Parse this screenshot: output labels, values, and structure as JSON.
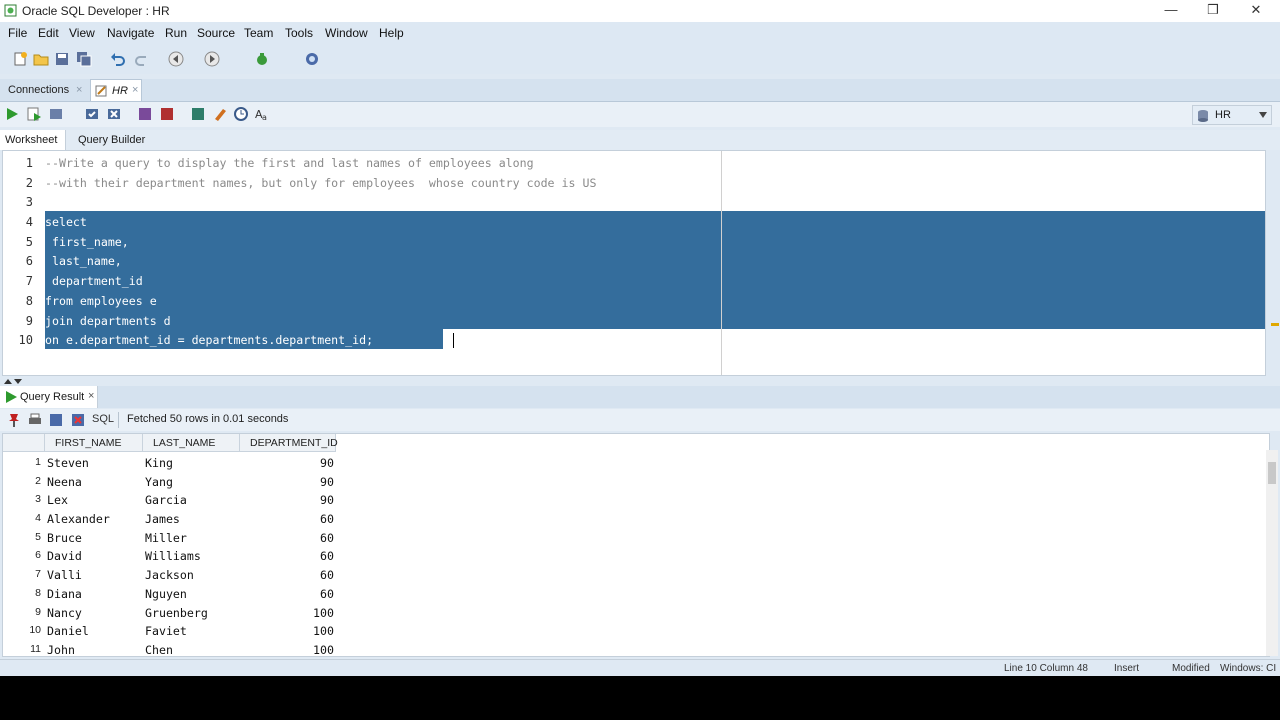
{
  "window": {
    "title": "Oracle SQL Developer : HR",
    "minimize": "—",
    "restore": "❒",
    "close": "✕"
  },
  "menu": [
    "File",
    "Edit",
    "View",
    "Navigate",
    "Run",
    "Source",
    "Team",
    "Tools",
    "Window",
    "Help"
  ],
  "tabs": {
    "connections": "Connections",
    "hr": "HR",
    "close_glyph": "×"
  },
  "connection_selector": "HR",
  "worksheet_tabs": {
    "worksheet": "Worksheet",
    "query_builder": "Query Builder"
  },
  "editor": {
    "lines": [
      "--Write a query to display the first and last names of employees along",
      "--with their department names, but only for employees  whose country code is US",
      "",
      "select",
      " first_name,",
      " last_name,",
      " department_id",
      "from employees e",
      "join departments d",
      "on e.department_id = departments.department_id;"
    ],
    "line_numbers": [
      "1",
      "2",
      "3",
      "4",
      "5",
      "6",
      "7",
      "8",
      "9",
      "10"
    ]
  },
  "results": {
    "tab_label": "Query Result",
    "sql_label": "SQL",
    "status": "Fetched 50 rows in 0.01 seconds",
    "columns": [
      "FIRST_NAME",
      "LAST_NAME",
      "DEPARTMENT_ID"
    ],
    "rows": [
      [
        "1",
        "Steven",
        "King",
        "90"
      ],
      [
        "2",
        "Neena",
        "Yang",
        "90"
      ],
      [
        "3",
        "Lex",
        "Garcia",
        "90"
      ],
      [
        "4",
        "Alexander",
        "James",
        "60"
      ],
      [
        "5",
        "Bruce",
        "Miller",
        "60"
      ],
      [
        "6",
        "David",
        "Williams",
        "60"
      ],
      [
        "7",
        "Valli",
        "Jackson",
        "60"
      ],
      [
        "8",
        "Diana",
        "Nguyen",
        "60"
      ],
      [
        "9",
        "Nancy",
        "Gruenberg",
        "100"
      ],
      [
        "10",
        "Daniel",
        "Faviet",
        "100"
      ],
      [
        "11",
        "John",
        "Chen",
        "100"
      ]
    ]
  },
  "statusbar": {
    "position": "Line 10 Column 48",
    "mode": "Insert",
    "state": "Modified",
    "platform": "Windows: CI"
  },
  "colors": {
    "selection": "#346d9c",
    "run_green": "#2e9a2e"
  }
}
